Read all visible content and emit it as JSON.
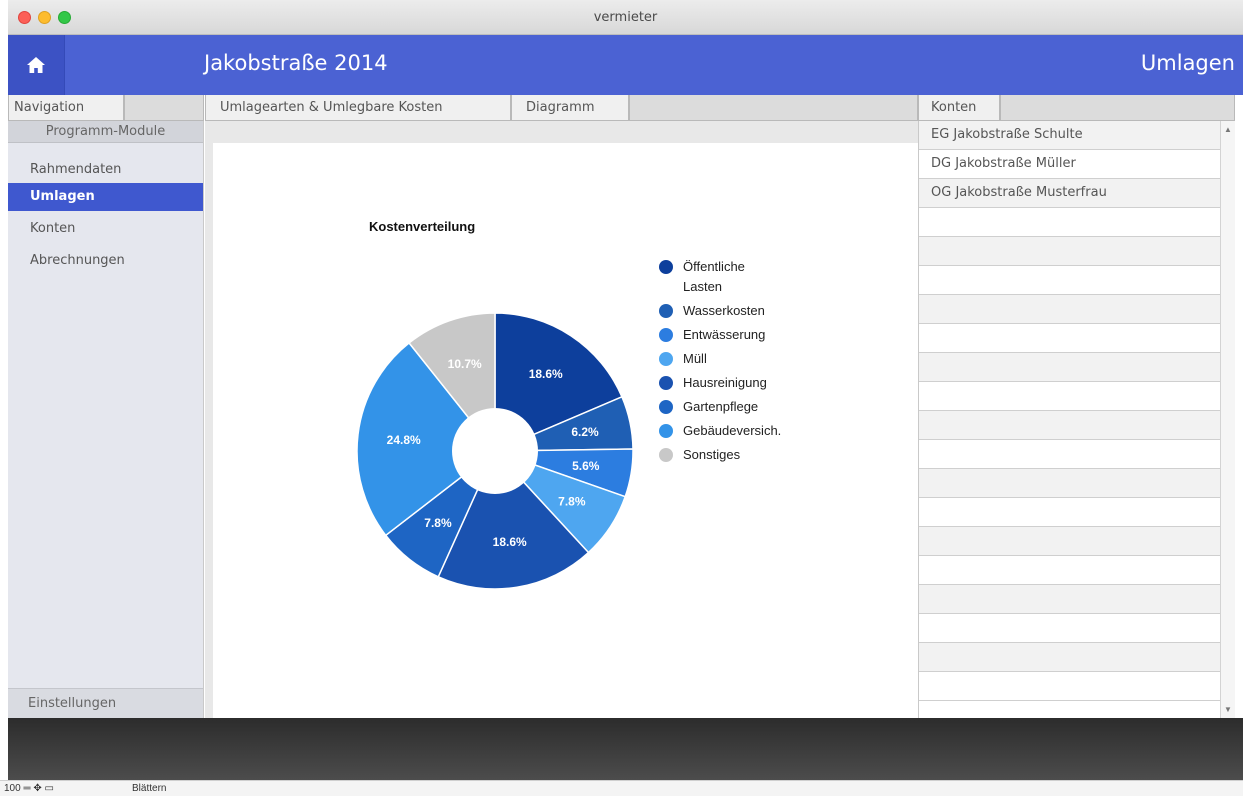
{
  "window": {
    "title": "vermieter"
  },
  "header": {
    "title": "Jakobstraße 2014",
    "section": "Umlagen"
  },
  "tabs": {
    "navigation": "Navigation",
    "umlagearten": "Umlagearten & Umlegbare Kosten",
    "diagramm": "Diagramm",
    "konten": "Konten"
  },
  "nav": {
    "section_label": "Programm-Module",
    "items": [
      {
        "label": "Rahmendaten"
      },
      {
        "label": "Umlagen"
      },
      {
        "label": "Konten"
      },
      {
        "label": "Abrechnungen"
      }
    ],
    "footer": "Einstellungen"
  },
  "konten": {
    "rows": [
      "EG Jakobstraße Schulte",
      "DG Jakobstraße Müller",
      "OG Jakobstraße Musterfrau"
    ]
  },
  "status": {
    "zoom": "100",
    "mode": "Blättern"
  },
  "colors": {
    "header": "#4b62d3",
    "nav_active": "#3f58cf"
  },
  "chart_data": {
    "type": "pie",
    "title": "Kostenverteilung",
    "donut": true,
    "legend_position": "right",
    "categories": [
      "Öffentliche Lasten",
      "Wasserkosten",
      "Entwässerung",
      "Müll",
      "Hausreinigung",
      "Gartenpflege",
      "Gebäudeversich.",
      "Sonstiges"
    ],
    "values": [
      18.6,
      6.2,
      5.6,
      7.8,
      18.6,
      7.8,
      24.8,
      10.7
    ],
    "labels": [
      "18.6%",
      "6.2%",
      "5.6%",
      "7.8%",
      "18.6%",
      "7.8%",
      "24.8%",
      "10.7%"
    ],
    "colors": [
      "#0d3f9c",
      "#1f5fb4",
      "#2c7de0",
      "#4ea6f0",
      "#1a52b0",
      "#1e65c4",
      "#3393e8",
      "#c8c8c8"
    ]
  }
}
